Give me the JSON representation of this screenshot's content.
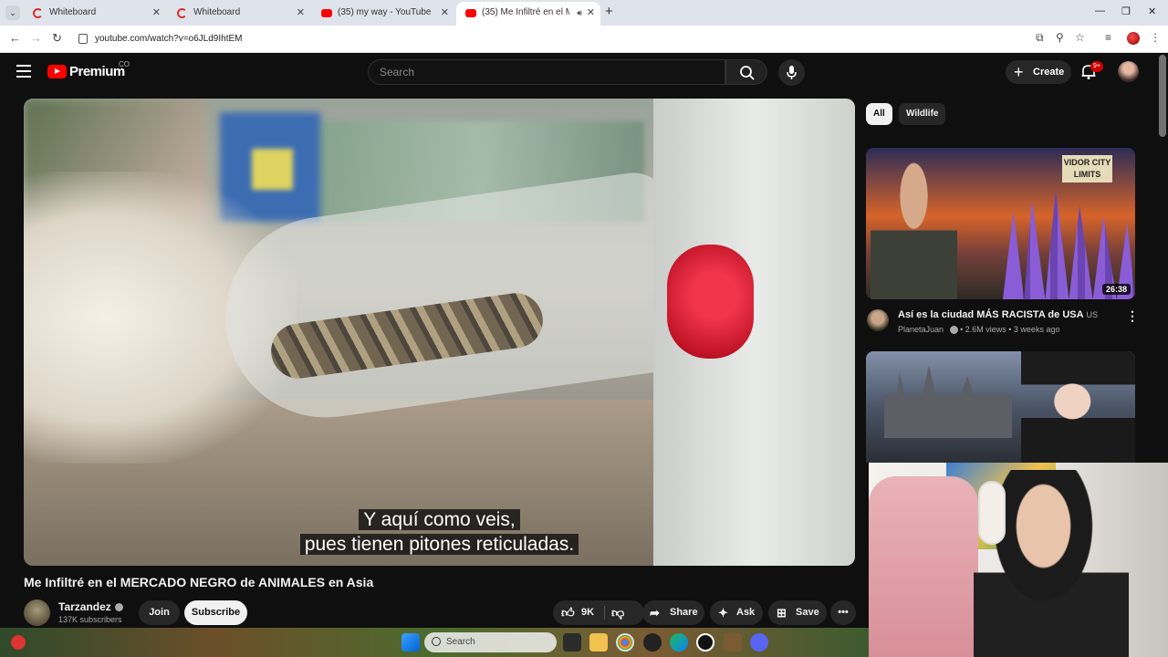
{
  "browser": {
    "tabs": [
      {
        "title": "Whiteboard",
        "icon": "whiteboard-icon"
      },
      {
        "title": "Whiteboard",
        "icon": "whiteboard-icon"
      },
      {
        "title": "(35) my way - YouTube",
        "icon": "youtube-icon"
      },
      {
        "title": "(35) Me Infiltré en el MERCA",
        "icon": "youtube-icon",
        "active": true
      }
    ],
    "url": "youtube.com/watch?v=o6JLd9IhtEM"
  },
  "header": {
    "logo_text": "Premium",
    "country_code": "CO",
    "search_placeholder": "Search",
    "create_label": "Create",
    "notification_count": "9+"
  },
  "player": {
    "subtitle_line1": "Y aquí como veis,",
    "subtitle_line2": "pues tienen pitones reticuladas."
  },
  "video": {
    "title": "Me Infiltré en el MERCADO NEGRO de ANIMALES en Asia",
    "channel_name": "Tarzandez",
    "subscribers": "137K subscribers",
    "join_label": "Join",
    "subscribe_label": "Subscribe",
    "likes": "9K",
    "share_label": "Share",
    "ask_label": "Ask",
    "save_label": "Save"
  },
  "sidebar": {
    "chips": [
      "All",
      "Wildlife"
    ],
    "recommendations": [
      {
        "title": "Así es la ciudad MÁS RACISTA de USA",
        "lang": "US",
        "channel": "PlanetaJuan",
        "views": "2.6M views",
        "age": "3 weeks ago",
        "duration": "26:38",
        "sign_text": "VIDOR CITY LIMITS"
      }
    ]
  },
  "taskbar": {
    "search_placeholder": "Search"
  },
  "colors": {
    "background": "#0f0f0f",
    "brand_red": "#ff0000",
    "subscribe_bg": "#f1f1f1"
  }
}
